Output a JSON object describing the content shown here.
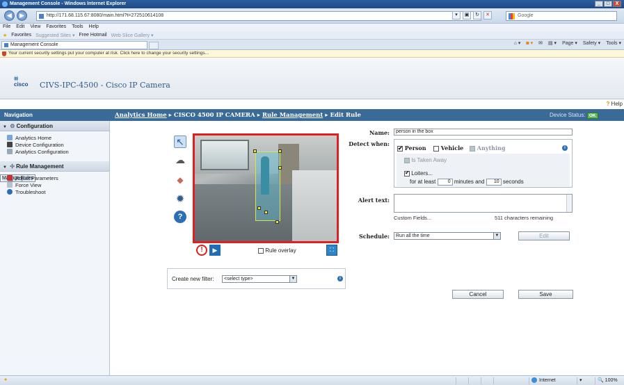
{
  "window": {
    "title": "Management Console - Windows Internet Explorer",
    "min": "_",
    "max": "□",
    "close": "X"
  },
  "browser": {
    "url": "http://171.68.115.67:8080/main.html?t=272510614108",
    "search_placeholder": "Google",
    "menu": [
      "File",
      "Edit",
      "View",
      "Favorites",
      "Tools",
      "Help"
    ],
    "favorites": {
      "label": "Favorites",
      "items": [
        "Suggested Sites ▾",
        "Free Hotmail",
        "Web Slice Gallery ▾"
      ]
    },
    "tab_title": "Management Console",
    "commands": [
      "Page ▾",
      "Safety ▾",
      "Tools ▾"
    ],
    "infobar": "Your current security settings put your computer at risk. Click here to change your security settings..."
  },
  "app": {
    "logo_text": "cisco",
    "title": "CIVS-IPC-4500 - Cisco IP Camera",
    "help": "Help",
    "nav_heading": "Navigation",
    "breadcrumb": {
      "home": "Analytics Home",
      "sep": "▸",
      "camera": "CISCO 4500 IP CAMERA",
      "rules": "Rule Management",
      "current": "Edit Rule"
    },
    "device_status_label": "Device Status:",
    "device_status_value": "OK"
  },
  "sidebar": {
    "configuration": {
      "title": "Configuration",
      "items": [
        "Analytics Home",
        "Device Configuration",
        "Analytics Configuration"
      ]
    },
    "rule_management": {
      "title": "Rule Management",
      "items": [
        "Manage Rules",
        "Adjust Parameters",
        "Force View",
        "Troubleshoot"
      ]
    }
  },
  "editor": {
    "rule_overlay_label": "Rule overlay",
    "create_filter_label": "Create new filter:",
    "filter_select": "<select type>"
  },
  "form": {
    "name_label": "Name:",
    "name_value": "person in the box",
    "detect_label": "Detect when:",
    "person": "Person",
    "vehicle": "Vehicle",
    "anything": "Anything",
    "taken_away": "Is Taken Away",
    "loiters": "Loiters...",
    "for_at_least": "for at least",
    "minutes_value": "0",
    "minutes_label": "minutes and",
    "seconds_value": "10",
    "seconds_label": "seconds",
    "alert_label": "Alert text:",
    "custom_fields": "Custom Fields...",
    "remaining": "511 characters remaining",
    "schedule_label": "Schedule:",
    "schedule_value": "Run all the time",
    "edit_button": "Edit",
    "cancel_button": "Cancel",
    "save_button": "Save"
  },
  "status": {
    "zone": "Internet",
    "zoom": "100%"
  }
}
